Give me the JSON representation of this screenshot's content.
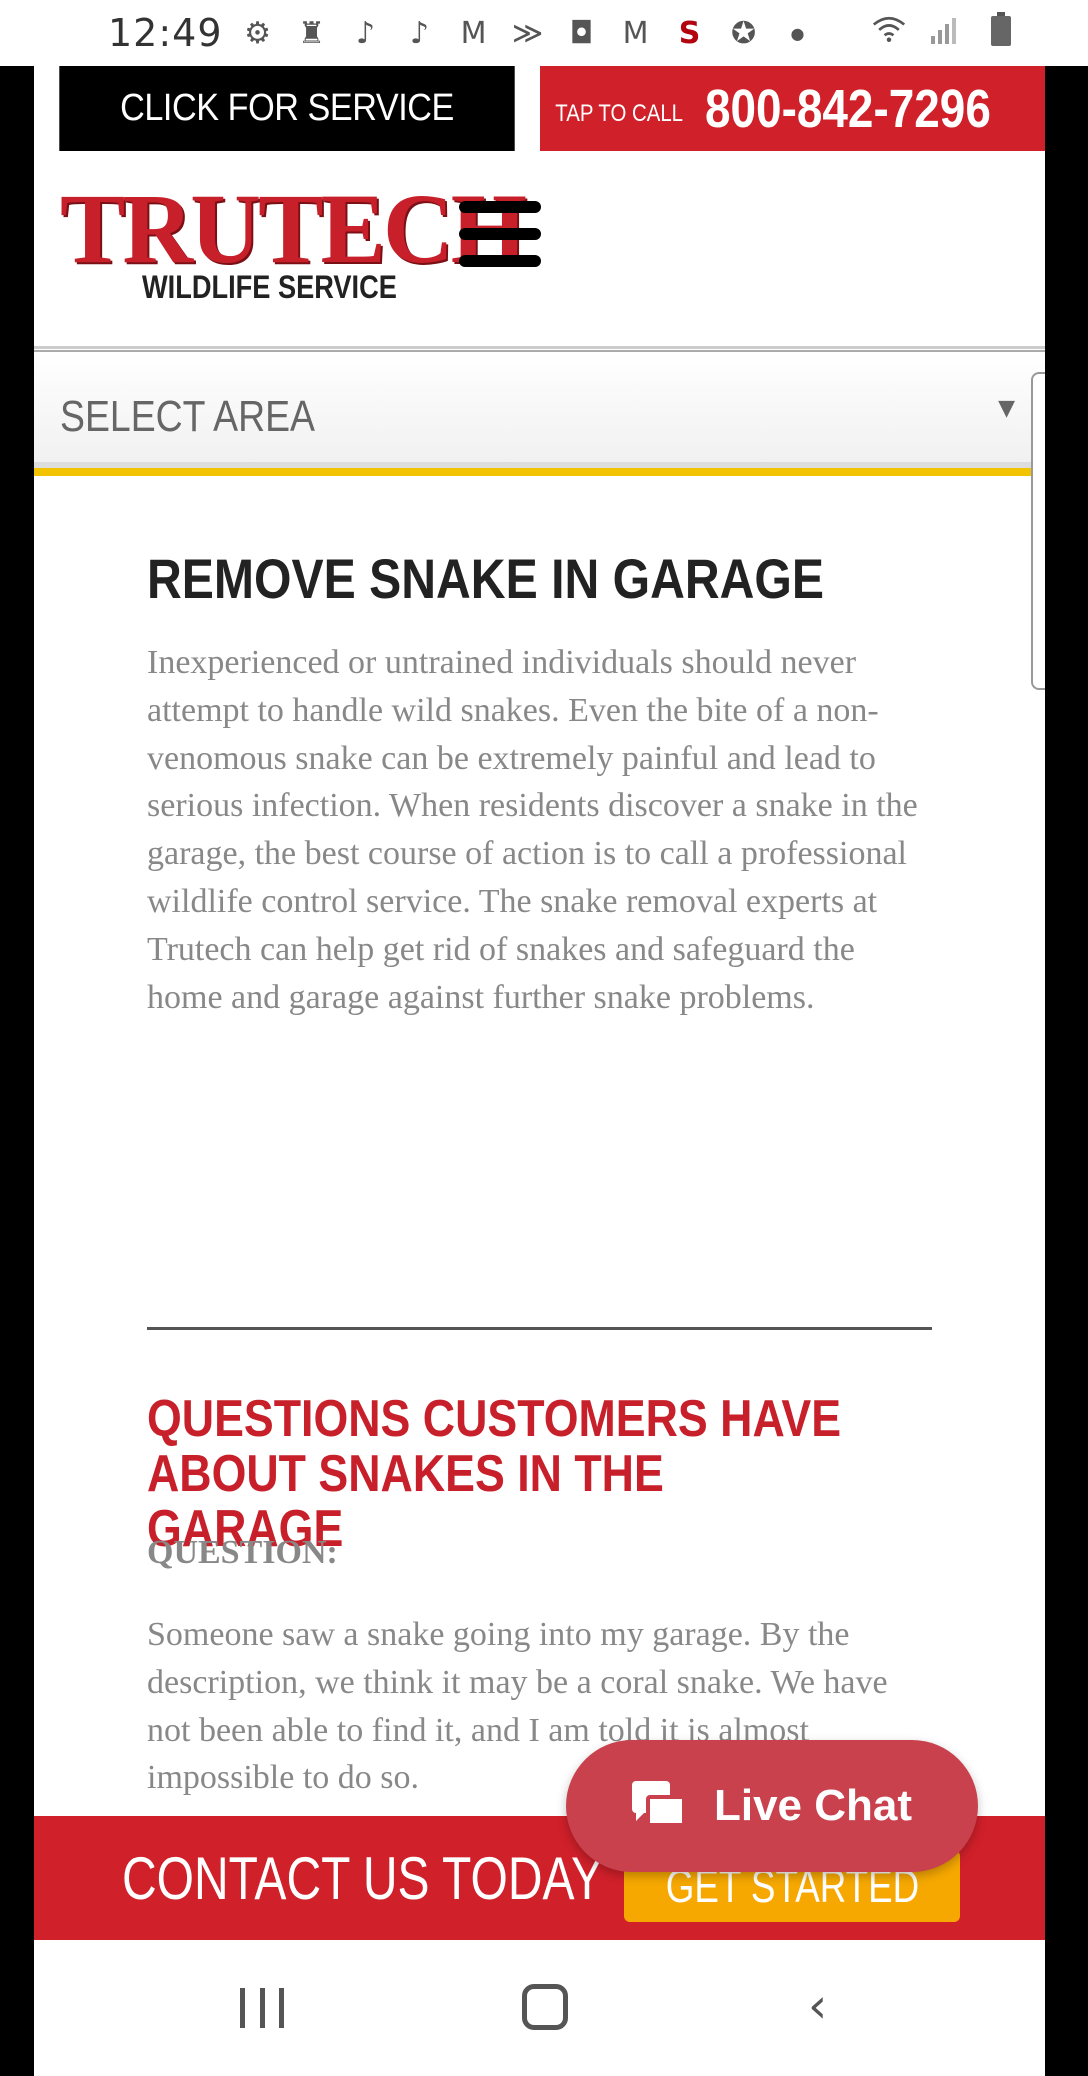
{
  "status_bar": {
    "time": "12:49",
    "icons": [
      "settings-icon",
      "chess-icon",
      "tiktok-icon",
      "tiktok-icon",
      "gmail-icon",
      "sprint-icon",
      "clock-app-icon",
      "gmail-icon",
      "stanford-icon",
      "star-icon",
      "dot-icon"
    ],
    "right_icons": [
      "wifi-icon",
      "signal-icon",
      "battery-icon"
    ]
  },
  "topbar": {
    "click_service": "CLICK FOR SERVICE",
    "tap_label": "TAP TO CALL",
    "phone": "800-842-7296"
  },
  "header": {
    "logo_main": "TRUTECH",
    "logo_sub": "WILDLIFE SERVICE"
  },
  "select": {
    "label": "SELECT AREA",
    "arrow": "▼"
  },
  "main": {
    "title": "REMOVE SNAKE IN GARAGE",
    "paragraph": "Inexperienced or untrained individuals should never attempt to handle wild snakes. Even the bite of a non-venomous snake can be extremely painful and lead to serious infection. When residents discover a snake in the garage, the best course of action is to call a professional wildlife control service. The snake removal experts at Trutech can help get rid of snakes and safeguard the home and garage against further snake problems.",
    "faq_title": "QUESTIONS CUSTOMERS HAVE ABOUT SNAKES IN THE GARAGE",
    "question_label": "QUESTION:",
    "question_text": "Someone saw a snake going into my garage. By the description, we think it may be a coral snake. We have not been able to find it, and I am told it is almost impossible to do so."
  },
  "footer": {
    "contact": "CONTACT US TODAY",
    "get_started": "GET STARTED"
  },
  "live_chat": {
    "label": "Live Chat"
  },
  "colors": {
    "brand_red": "#d0202a",
    "cta_orange": "#f6a800",
    "chat_red": "#c8414d",
    "divider_yellow": "#f2c300"
  }
}
